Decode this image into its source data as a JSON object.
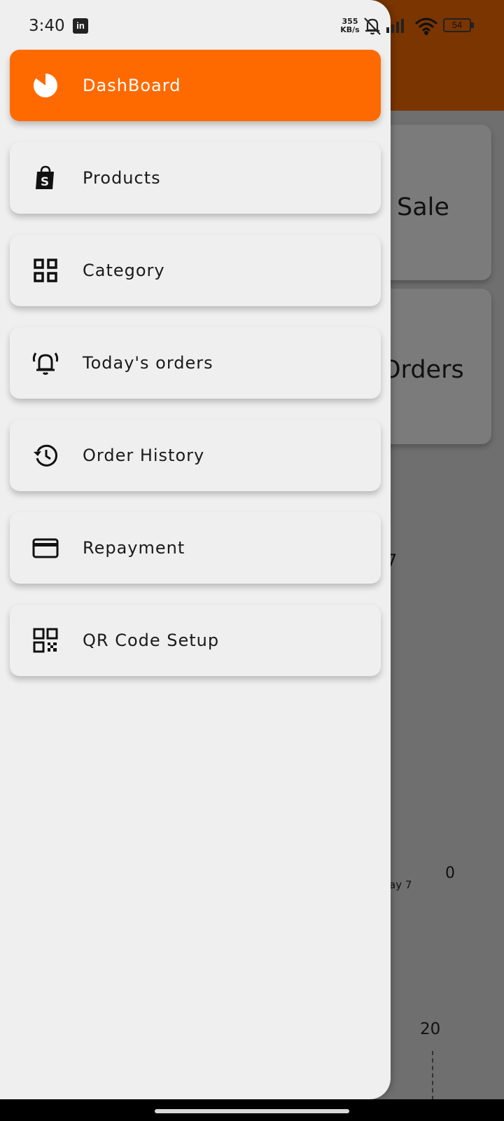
{
  "status_bar": {
    "time": "3:40",
    "linkedin_icon": "linkedin-icon",
    "net_speed_value": "355",
    "net_speed_unit": "KB/s",
    "battery": "54"
  },
  "background": {
    "card_sale_label": "Sale",
    "card_orders_label": "Orders",
    "value_seven": "7",
    "chart_x_label": "ay 7",
    "chart_zero": "0",
    "chart_twenty": "20",
    "header_color": "#7a3500"
  },
  "drawer": {
    "accent_color": "#ff6a00",
    "items": [
      {
        "label": "DashBoard",
        "icon": "pie-chart-icon",
        "active": true
      },
      {
        "label": "Products",
        "icon": "shopping-bag-icon",
        "active": false
      },
      {
        "label": "Category",
        "icon": "grid-icon",
        "active": false
      },
      {
        "label": "Today's orders",
        "icon": "bell-ring-icon",
        "active": false
      },
      {
        "label": "Order History",
        "icon": "history-icon",
        "active": false
      },
      {
        "label": "Repayment",
        "icon": "credit-card-icon",
        "active": false
      },
      {
        "label": "QR Code Setup",
        "icon": "qr-code-icon",
        "active": false
      }
    ]
  }
}
